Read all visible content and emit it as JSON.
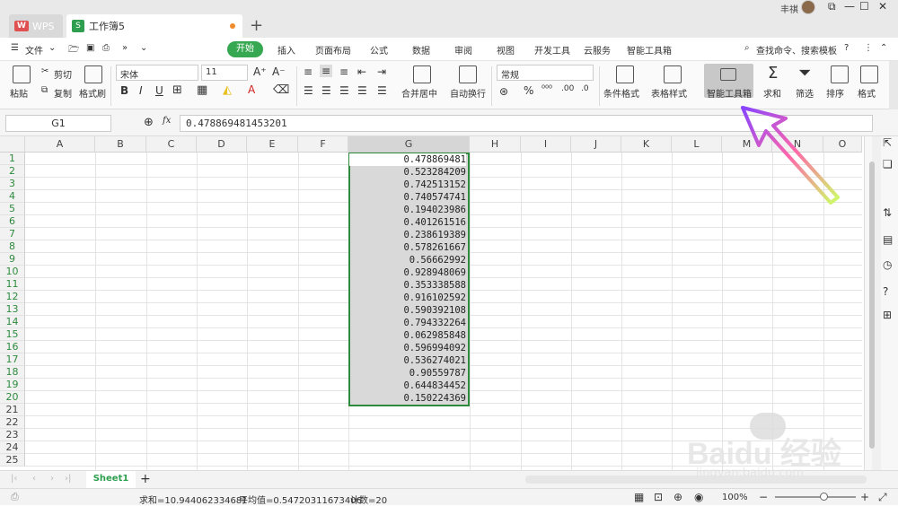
{
  "titlebar": {
    "wps_tab": "WPS",
    "book_tab": "工作簿5",
    "new_tab": "+",
    "user": "丰祺"
  },
  "menubar": {
    "file": "文件",
    "items": [
      "开始",
      "插入",
      "页面布局",
      "公式",
      "数据",
      "审阅",
      "视图",
      "开发工具",
      "云服务",
      "智能工具箱"
    ],
    "search": "查找命令、搜索模板"
  },
  "ribbon": {
    "paste": "粘贴",
    "cut": "剪切",
    "copy": "复制",
    "format_painter": "格式刷",
    "font_name": "宋体",
    "font_size": "11",
    "bold": "B",
    "italic": "I",
    "underline": "U",
    "merge": "合并居中",
    "wrap": "自动换行",
    "number_format": "常规",
    "cond_format": "条件格式",
    "table_style": "表格样式",
    "smart_toolbox": "智能工具箱",
    "sum": "求和",
    "filter": "筛选",
    "sort": "排序",
    "format": "格式"
  },
  "formula": {
    "cell_ref": "G1",
    "fx": "fx",
    "value": "0.478869481453201"
  },
  "grid": {
    "columns": [
      "A",
      "B",
      "C",
      "D",
      "E",
      "F",
      "G",
      "H",
      "I",
      "J",
      "K",
      "L",
      "M",
      "N",
      "O"
    ],
    "rows": [
      "1",
      "2",
      "3",
      "4",
      "5",
      "6",
      "7",
      "8",
      "9",
      "10",
      "11",
      "12",
      "13",
      "14",
      "15",
      "16",
      "17",
      "18",
      "19",
      "20",
      "21",
      "22",
      "23",
      "24",
      "25"
    ],
    "g_values": [
      "0.478869481",
      "0.523284209",
      "0.742513152",
      "0.740574741",
      "0.194023986",
      "0.401261516",
      "0.238619389",
      "0.578261667",
      "0.56662992",
      "0.928948069",
      "0.353338588",
      "0.916102592",
      "0.590392108",
      "0.794332264",
      "0.062985848",
      "0.596994092",
      "0.536274021",
      "0.90559787",
      "0.644834452",
      "0.150224369"
    ]
  },
  "sheetbar": {
    "sheet": "Sheet1",
    "add": "+"
  },
  "status": {
    "sum": "求和=10.944062334681",
    "avg": "平均值=0.54720311673406",
    "count": "计数=20",
    "zoom": "100%"
  },
  "watermark": {
    "brand": "Bai",
    "brand2": "du",
    "cn": "经验",
    "url": "jingyan.baidu.com"
  }
}
